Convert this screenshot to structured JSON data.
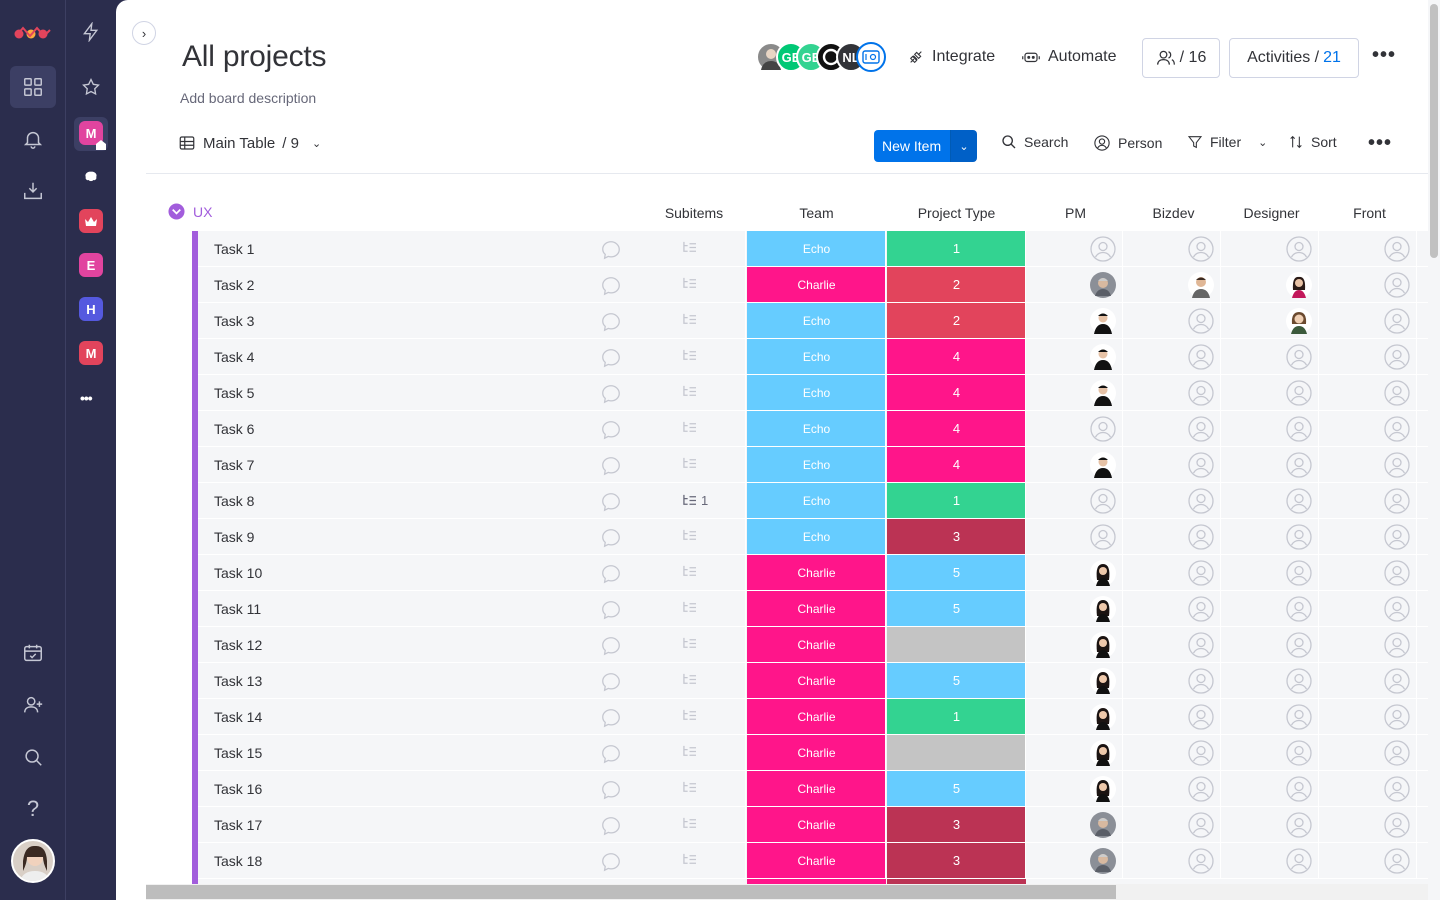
{
  "sidebar": {
    "nav_icons": [
      "logo-icon",
      "workspace-icon",
      "bell-icon",
      "inbox-icon",
      "calendar-icon",
      "invite-icon",
      "search-icon",
      "help-icon",
      "profile-avatar"
    ],
    "workspaces": [
      {
        "letter": "M",
        "color": "#e1449f"
      },
      {
        "letter": "",
        "color": "#2b2d4d"
      },
      {
        "letter": "",
        "color": "#e2445c"
      },
      {
        "letter": "E",
        "color": "#e2445c"
      },
      {
        "letter": "H",
        "color": "#5559df"
      },
      {
        "letter": "M",
        "color": "#e2445c"
      }
    ],
    "more": "•••"
  },
  "board": {
    "title": "All projects",
    "description": "Add board description",
    "avatars": [
      "",
      "GE",
      "GE",
      "",
      "NL",
      ""
    ],
    "integrate_label": "Integrate",
    "automate_label": "Automate",
    "members_count": "/ 16",
    "activities_label": "Activities /",
    "activities_count": "21"
  },
  "toolbar": {
    "view_label": "Main Table",
    "view_count": "/ 9",
    "new_item_label": "New Item",
    "search_label": "Search",
    "person_label": "Person",
    "filter_label": "Filter",
    "sort_label": "Sort"
  },
  "group": {
    "name": "UX",
    "color": "#a25ddc"
  },
  "columns": [
    "Subitems",
    "Team",
    "Project Type",
    "PM",
    "Bizdev",
    "Designer",
    "Front"
  ],
  "colors": {
    "Echo": "#66ccff",
    "Charlie": "#ff158a",
    "1": "#33d391",
    "2": "#e2445c",
    "3": "#bb3354",
    "4": "#ff158a",
    "5": "#66ccff",
    "": "#c4c4c4"
  },
  "rows": [
    {
      "name": "Task 1",
      "subitems": "",
      "team": "Echo",
      "ptype": "1",
      "pm": "",
      "bizdev": "",
      "designer": "",
      "front": ""
    },
    {
      "name": "Task 2",
      "subitems": "",
      "team": "Charlie",
      "ptype": "2",
      "pm": "a",
      "bizdev": "b",
      "designer": "c",
      "front": ""
    },
    {
      "name": "Task 3",
      "subitems": "",
      "team": "Echo",
      "ptype": "2",
      "pm": "d",
      "bizdev": "",
      "designer": "e",
      "front": ""
    },
    {
      "name": "Task 4",
      "subitems": "",
      "team": "Echo",
      "ptype": "4",
      "pm": "d",
      "bizdev": "",
      "designer": "",
      "front": ""
    },
    {
      "name": "Task 5",
      "subitems": "",
      "team": "Echo",
      "ptype": "4",
      "pm": "d",
      "bizdev": "",
      "designer": "",
      "front": ""
    },
    {
      "name": "Task 6",
      "subitems": "",
      "team": "Echo",
      "ptype": "4",
      "pm": "",
      "bizdev": "",
      "designer": "",
      "front": ""
    },
    {
      "name": "Task 7",
      "subitems": "",
      "team": "Echo",
      "ptype": "4",
      "pm": "d",
      "bizdev": "",
      "designer": "",
      "front": ""
    },
    {
      "name": "Task 8",
      "subitems": "1",
      "team": "Echo",
      "ptype": "1",
      "pm": "",
      "bizdev": "",
      "designer": "",
      "front": ""
    },
    {
      "name": "Task 9",
      "subitems": "",
      "team": "Echo",
      "ptype": "3",
      "pm": "",
      "bizdev": "",
      "designer": "",
      "front": ""
    },
    {
      "name": "Task 10",
      "subitems": "",
      "team": "Charlie",
      "ptype": "5",
      "pm": "f",
      "bizdev": "",
      "designer": "",
      "front": ""
    },
    {
      "name": "Task 11",
      "subitems": "",
      "team": "Charlie",
      "ptype": "5",
      "pm": "f",
      "bizdev": "",
      "designer": "",
      "front": ""
    },
    {
      "name": "Task 12",
      "subitems": "",
      "team": "Charlie",
      "ptype": "",
      "pm": "f",
      "bizdev": "",
      "designer": "",
      "front": ""
    },
    {
      "name": "Task 13",
      "subitems": "",
      "team": "Charlie",
      "ptype": "5",
      "pm": "f",
      "bizdev": "",
      "designer": "",
      "front": ""
    },
    {
      "name": "Task 14",
      "subitems": "",
      "team": "Charlie",
      "ptype": "1",
      "pm": "f",
      "bizdev": "",
      "designer": "",
      "front": ""
    },
    {
      "name": "Task 15",
      "subitems": "",
      "team": "Charlie",
      "ptype": "",
      "pm": "f",
      "bizdev": "",
      "designer": "",
      "front": ""
    },
    {
      "name": "Task 16",
      "subitems": "",
      "team": "Charlie",
      "ptype": "5",
      "pm": "f",
      "bizdev": "",
      "designer": "",
      "front": ""
    },
    {
      "name": "Task 17",
      "subitems": "",
      "team": "Charlie",
      "ptype": "3",
      "pm": "a",
      "bizdev": "",
      "designer": "",
      "front": ""
    },
    {
      "name": "Task 18",
      "subitems": "",
      "team": "Charlie",
      "ptype": "3",
      "pm": "a",
      "bizdev": "",
      "designer": "",
      "front": ""
    }
  ]
}
